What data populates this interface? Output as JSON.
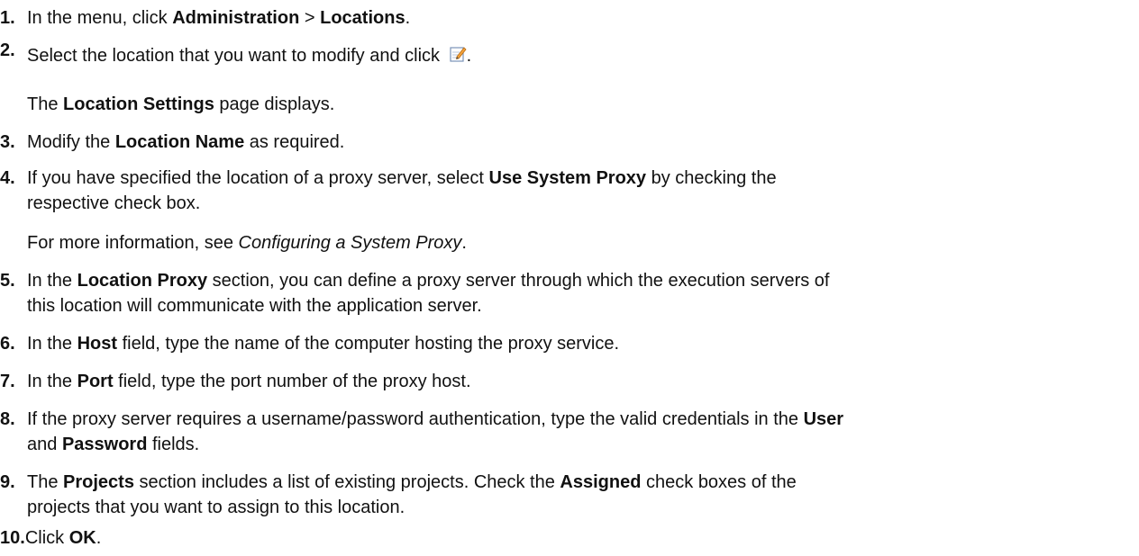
{
  "steps": [
    {
      "num": "1.",
      "parts": [
        "In the menu, click ",
        "Administration",
        " > ",
        "Locations",
        "."
      ]
    },
    {
      "num": "2.",
      "parts": [
        "Select the location that you want to modify and click ",
        "."
      ]
    },
    {
      "note2": [
        "The ",
        "Location Settings",
        " page displays."
      ]
    },
    {
      "num": "3.",
      "parts": [
        "Modify the ",
        "Location Name",
        " as required."
      ]
    },
    {
      "num": "4.",
      "parts": [
        "If you have specified the location of a proxy server, select ",
        "Use System Proxy",
        " by checking the",
        "respective check box."
      ]
    },
    {
      "note4": [
        "For more information, see ",
        "Configuring a System Proxy",
        "."
      ]
    },
    {
      "num": "5.",
      "parts": [
        "In the ",
        "Location Proxy",
        " section, you can define a proxy server through which the execution servers of",
        "this location will communicate with the application server."
      ]
    },
    {
      "num": "6.",
      "parts": [
        "In the ",
        "Host",
        " field, type the name of the computer hosting the proxy service."
      ]
    },
    {
      "num": "7.",
      "parts": [
        "In the ",
        "Port",
        " field, type the port number of the proxy host."
      ]
    },
    {
      "num": "8.",
      "parts": [
        "If the proxy server requires a username/password authentication, type the valid credentials in the ",
        "User",
        "and ",
        "Password",
        " fields."
      ]
    },
    {
      "num": "9.",
      "parts": [
        "The ",
        "Projects",
        " section includes a list of existing projects. Check the ",
        "Assigned",
        " check boxes of the",
        "projects that you want to assign to this location."
      ]
    },
    {
      "num": "10.",
      "parts": [
        "Click ",
        "OK",
        "."
      ]
    }
  ],
  "icons": {
    "edit": "edit-icon"
  }
}
